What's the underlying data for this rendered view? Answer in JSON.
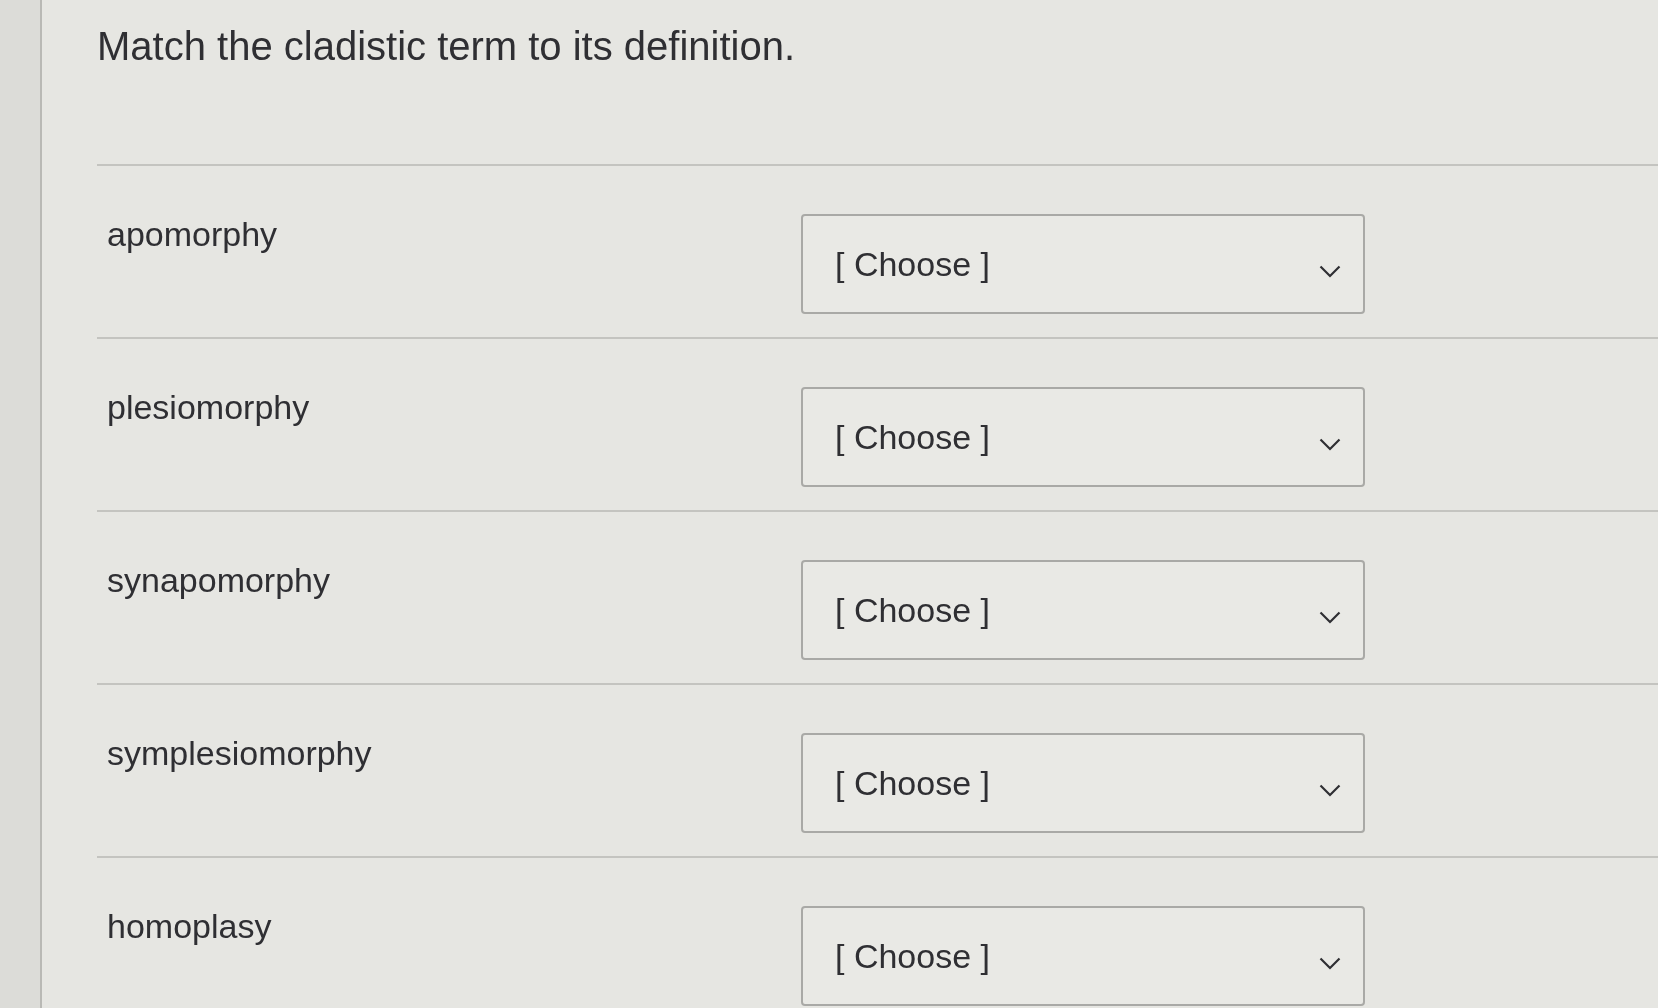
{
  "question": {
    "prompt": "Match the cladistic term to its definition."
  },
  "pairs": [
    {
      "term": "apomorphy",
      "selection": "[ Choose ]"
    },
    {
      "term": "plesiomorphy",
      "selection": "[ Choose ]"
    },
    {
      "term": "synapomorphy",
      "selection": "[ Choose ]"
    },
    {
      "term": "symplesiomorphy",
      "selection": "[ Choose ]"
    },
    {
      "term": "homoplasy",
      "selection": "[ Choose ]"
    }
  ]
}
